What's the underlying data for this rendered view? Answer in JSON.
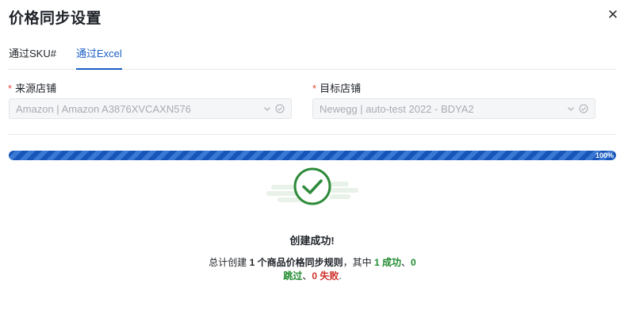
{
  "dialog": {
    "title": "价格同步设置",
    "close_icon": "close-icon"
  },
  "tabs": [
    {
      "label": "通过SKU#",
      "active": false
    },
    {
      "label": "通过Excel",
      "active": true
    }
  ],
  "form": {
    "required_mark": "*",
    "source": {
      "label": "来源店铺",
      "value": "Amazon | Amazon A3876XVCAXN576"
    },
    "target": {
      "label": "目标店铺",
      "value": "Newegg | auto-test 2022 - BDYA2"
    }
  },
  "progress": {
    "value": 1.0,
    "label": "100%"
  },
  "result": {
    "title": "创建成功!",
    "text_1": "总计创建 ",
    "count": "1",
    "text_2": " 个商品价格同步规则",
    "text_3": "，其中 ",
    "success_count": "1",
    "success_label": " 成功",
    "sep_1": "、",
    "skip_count": "0",
    "skip_label": " 跳过",
    "sep_2": "、",
    "fail_count": "0",
    "fail_label": " 失败",
    "end": "."
  },
  "colors": {
    "accent": "#1b5fc4",
    "success": "#2e8b3a",
    "danger": "#d0312d",
    "required": "#e5483b"
  }
}
